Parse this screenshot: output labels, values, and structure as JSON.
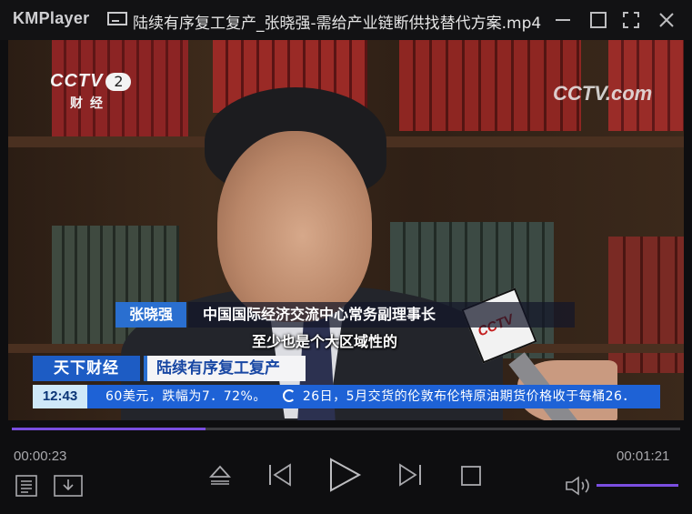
{
  "app": {
    "name": "KMPlayer",
    "file_title": "陆续有序复工复产_张晓强-需给产业链断供找替代方案.mp4"
  },
  "window_controls": [
    "minimize",
    "maximize",
    "fullscreen",
    "close"
  ],
  "video": {
    "channel_logo": "CCTV",
    "channel_number": "2",
    "channel_name": "财经",
    "watermark": "CCTV.com",
    "watermark_prefix": "CCTV",
    "watermark_suffix": "com",
    "mic_logo": "CCTV",
    "speaker_name": "张晓强",
    "speaker_title": "中国国际经济交流中心常务副理事长",
    "subtitle": "至少也是个大区域性的",
    "program_name": "天下财经",
    "segment_title": "陆续有序复工复产",
    "ticker_time": "12:43",
    "ticker_text_1": "60美元，跌幅为7．72%。",
    "ticker_text_2": "26日，5月交货的伦敦布伦特原油期货价格收于每桶26．"
  },
  "playback": {
    "current_time": "00:00:23",
    "total_time": "00:01:21",
    "progress_fraction": 0.29,
    "volume_fraction": 1.0
  },
  "colors": {
    "accent": "#7a4ee0",
    "ticker_blue": "#1e62d6",
    "banner_blue": "#1d5cc4"
  },
  "icons": {
    "playlist": "playlist-icon",
    "download": "download-icon",
    "eject": "eject-icon",
    "previous": "previous-icon",
    "play": "play-icon",
    "next": "next-icon",
    "stop": "stop-icon",
    "volume": "volume-icon"
  }
}
